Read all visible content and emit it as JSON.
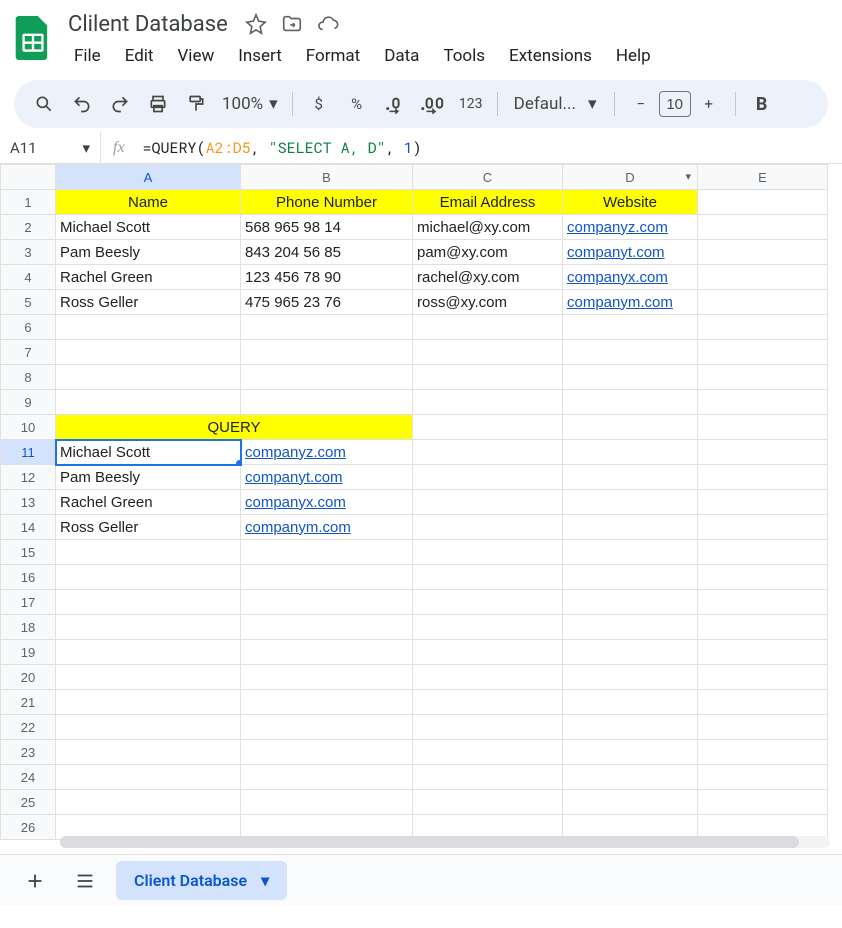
{
  "doc": {
    "title": "Clilent Database"
  },
  "menu": [
    "File",
    "Edit",
    "View",
    "Insert",
    "Format",
    "Data",
    "Tools",
    "Extensions",
    "Help"
  ],
  "toolbar": {
    "zoom": "100%",
    "currency": "$",
    "percent": "%",
    "num123": "123",
    "font_name": "Defaul...",
    "font_size": "10",
    "bold": "B"
  },
  "namebox": "A11",
  "formula": {
    "prefix": "=QUERY(",
    "range": "A2:D5",
    "sep1": ", ",
    "str": "\"SELECT A, D\"",
    "sep2": ", ",
    "num": "1",
    "suffix": ")"
  },
  "columns": [
    "A",
    "B",
    "C",
    "D",
    "E"
  ],
  "row_count": 26,
  "headers": {
    "name": "Name",
    "phone": "Phone Number",
    "email": "Email Address",
    "website": "Website"
  },
  "clients": [
    {
      "name": "Michael Scott",
      "phone": "568 965 98 14",
      "email": "michael@xy.com",
      "website": "companyz.com"
    },
    {
      "name": "Pam Beesly",
      "phone": "843 204 56 85",
      "email": "pam@xy.com",
      "website": "companyt.com"
    },
    {
      "name": "Rachel Green",
      "phone": "123 456 78 90",
      "email": "rachel@xy.com",
      "website": "companyx.com"
    },
    {
      "name": "Ross Geller",
      "phone": "475 965 23 76",
      "email": "ross@xy.com",
      "website": "companym.com"
    }
  ],
  "query_label": "QUERY",
  "query_results": [
    {
      "name": "Michael Scott",
      "website": "companyz.com"
    },
    {
      "name": "Pam Beesly",
      "website": "companyt.com"
    },
    {
      "name": "Rachel Green",
      "website": "companyx.com"
    },
    {
      "name": "Ross Geller",
      "website": "companym.com"
    }
  ],
  "sheet_tab": "Client Database"
}
